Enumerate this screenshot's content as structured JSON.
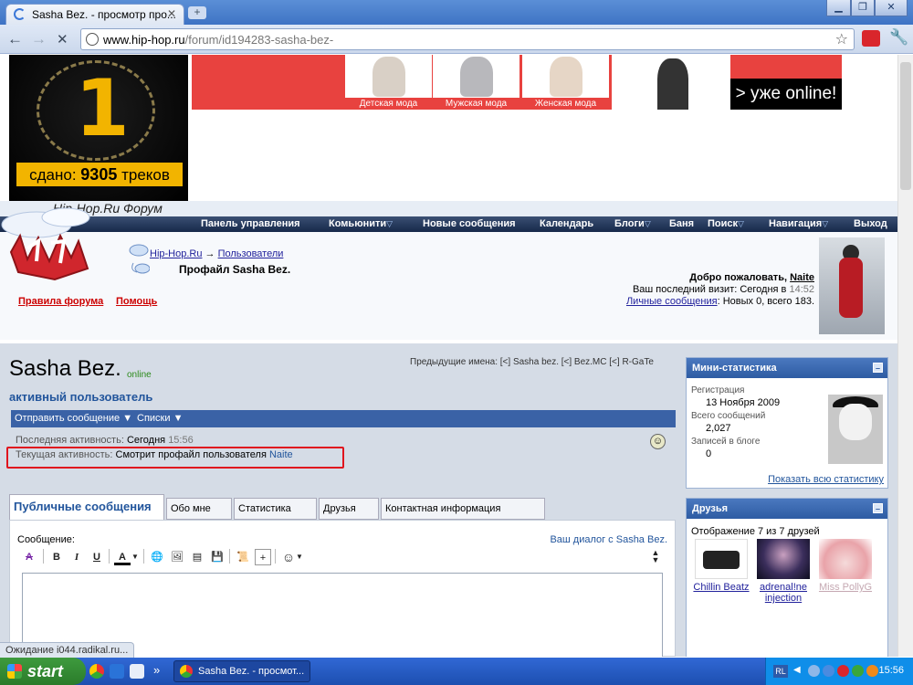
{
  "browser": {
    "tab_title": "Sasha Bez. - просмотр про...",
    "url_host": "www.hip-hop.ru",
    "url_path": "/forum/id194283-sasha-bez-",
    "status_text": "Ожидание i044.radikal.ru..."
  },
  "ads": {
    "tracks_counter_prefix": "сдано:",
    "tracks_counter_value": "9305",
    "tracks_counter_suffix": "треков",
    "fashion_labels": [
      "Детская мода",
      "Мужская мода",
      "Женская мода"
    ],
    "online_label": "> уже online!"
  },
  "forum": {
    "logo_text": "Hip-Hop.Ru Форум",
    "nav": [
      {
        "label": "Панель управления",
        "dropdown": false
      },
      {
        "label": "Комьюнити",
        "dropdown": true
      },
      {
        "label": "Новые сообщения",
        "dropdown": false
      },
      {
        "label": "Календарь",
        "dropdown": false
      },
      {
        "label": "Блоги",
        "dropdown": true
      },
      {
        "label": "Баня",
        "dropdown": false
      },
      {
        "label": "Поиск",
        "dropdown": true
      },
      {
        "label": "Навигация",
        "dropdown": true
      },
      {
        "label": "Выход",
        "dropdown": false
      }
    ],
    "breadcrumb": {
      "home": "Hip-Hop.Ru",
      "arrow": "→",
      "users": "Пользователи"
    },
    "page_title": "Профайл Sasha Bez.",
    "rules_link": "Правила форума",
    "help_link": "Помощь",
    "welcome": {
      "greeting": "Добро пожаловать,",
      "user": "Naite",
      "last_visit_label": "Ваш последний визит: Сегодня в",
      "last_visit_time": "14:52",
      "pm_link": "Личные сообщения",
      "pm_text": ": Новых 0, всего 183."
    }
  },
  "profile": {
    "username": "Sasha Bez.",
    "online_status": "online",
    "previous_names": "Предыдущие имена: [<] Sasha bez. [<] Bez.MC [<] R-GaTe",
    "user_title": "активный пользователь",
    "actions": [
      "Отправить сообщение",
      "Списки"
    ],
    "last_activity_label": "Последняя активность:",
    "last_activity_day": "Сегодня",
    "last_activity_time": "15:56",
    "current_activity_label": "Текущая активность:",
    "current_activity_text": "Смотрит профайл пользователя",
    "current_activity_user": "Naite"
  },
  "tabs": [
    "Публичные сообщения",
    "Обо мне",
    "Статистика",
    "Друзья",
    "Контактная информация"
  ],
  "message": {
    "label": "Сообщение:",
    "dialog_link": "Ваш диалог с Sasha Bez."
  },
  "mini_stats": {
    "title": "Мини-статистика",
    "items": [
      {
        "label": "Регистрация",
        "value": "13 Ноября 2009"
      },
      {
        "label": "Всего сообщений",
        "value": "2,027"
      },
      {
        "label": "Записей в блоге",
        "value": "0"
      }
    ],
    "show_all": "Показать всю статистику"
  },
  "friends": {
    "title": "Друзья",
    "summary": "Отображение 7 из 7 друзей",
    "list": [
      "Chillin Beatz",
      "adrenal!ne injection",
      "Miss PollyG"
    ]
  },
  "taskbar": {
    "start_label": "start",
    "task_label": "Sasha Bez. - просмот...",
    "lang": "RL",
    "clock": "15:56"
  }
}
